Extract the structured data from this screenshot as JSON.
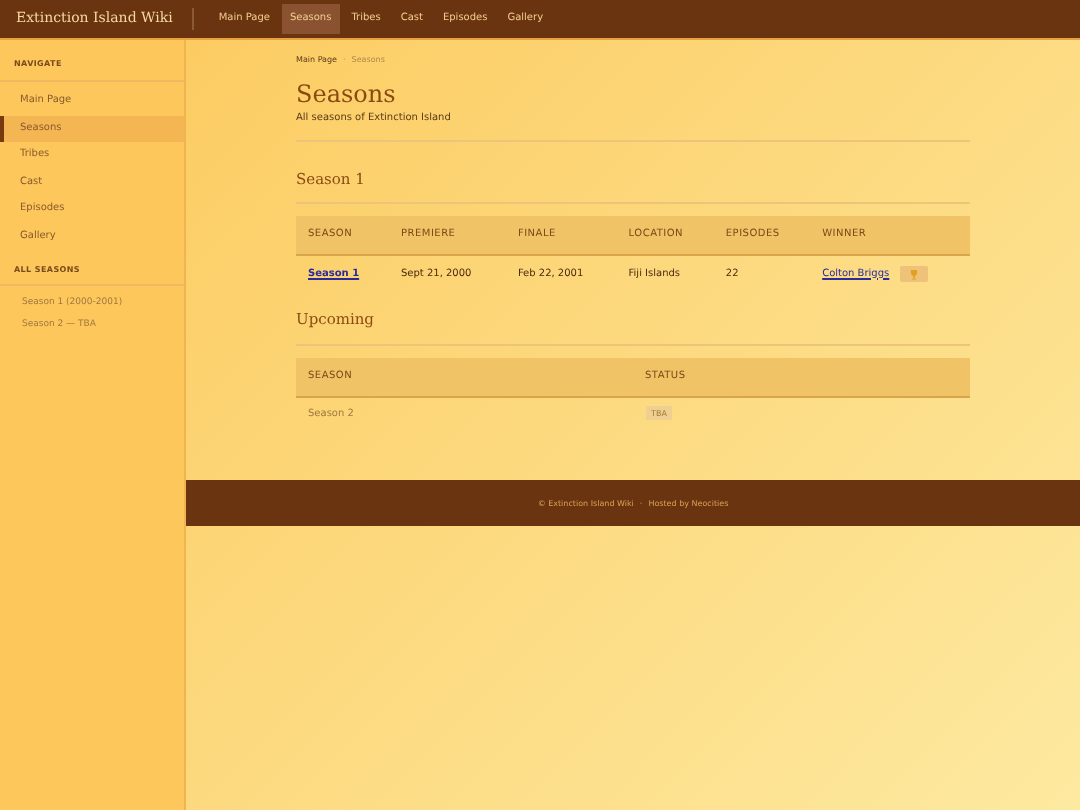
{
  "site_title": "Extinction Island Wiki",
  "nav": [
    {
      "label": "Main Page",
      "selected": false
    },
    {
      "label": "Seasons",
      "selected": true
    },
    {
      "label": "Tribes",
      "selected": false
    },
    {
      "label": "Cast",
      "selected": false
    },
    {
      "label": "Episodes",
      "selected": false
    },
    {
      "label": "Gallery",
      "selected": false
    }
  ],
  "sidebar": {
    "navigate_heading": "NAVIGATE",
    "items": [
      {
        "label": "Main Page",
        "selected": false
      },
      {
        "label": "Seasons",
        "selected": true
      },
      {
        "label": "Tribes",
        "selected": false
      },
      {
        "label": "Cast",
        "selected": false
      },
      {
        "label": "Episodes",
        "selected": false
      },
      {
        "label": "Gallery",
        "selected": false
      }
    ],
    "seasons_heading": "ALL SEASONS",
    "season_links": [
      "Season 1 (2000-2001)",
      "Season 2 — TBA"
    ]
  },
  "breadcrumb": {
    "items": [
      "Main Page",
      "Seasons"
    ],
    "separator": "·"
  },
  "page_title": "Seasons",
  "subtitle": "All seasons of Extinction Island",
  "season1": {
    "heading": "Season 1",
    "columns": [
      "SEASON",
      "PREMIERE",
      "FINALE",
      "LOCATION",
      "EPISODES",
      "WINNER"
    ],
    "rows": [
      {
        "season": "Season 1",
        "premiere": "Sept 21, 2000",
        "finale": "Feb 22, 2001",
        "location": "Fiji Islands",
        "episodes": "22",
        "winner": "Colton Briggs"
      }
    ]
  },
  "upcoming": {
    "heading": "Upcoming",
    "columns": [
      "SEASON",
      "STATUS"
    ],
    "rows": [
      {
        "season": "Season 2",
        "status": "TBA"
      }
    ]
  },
  "footer": {
    "copyright": "© Extinction Island Wiki",
    "separator": "·",
    "hosted": "Hosted by Neocities"
  }
}
